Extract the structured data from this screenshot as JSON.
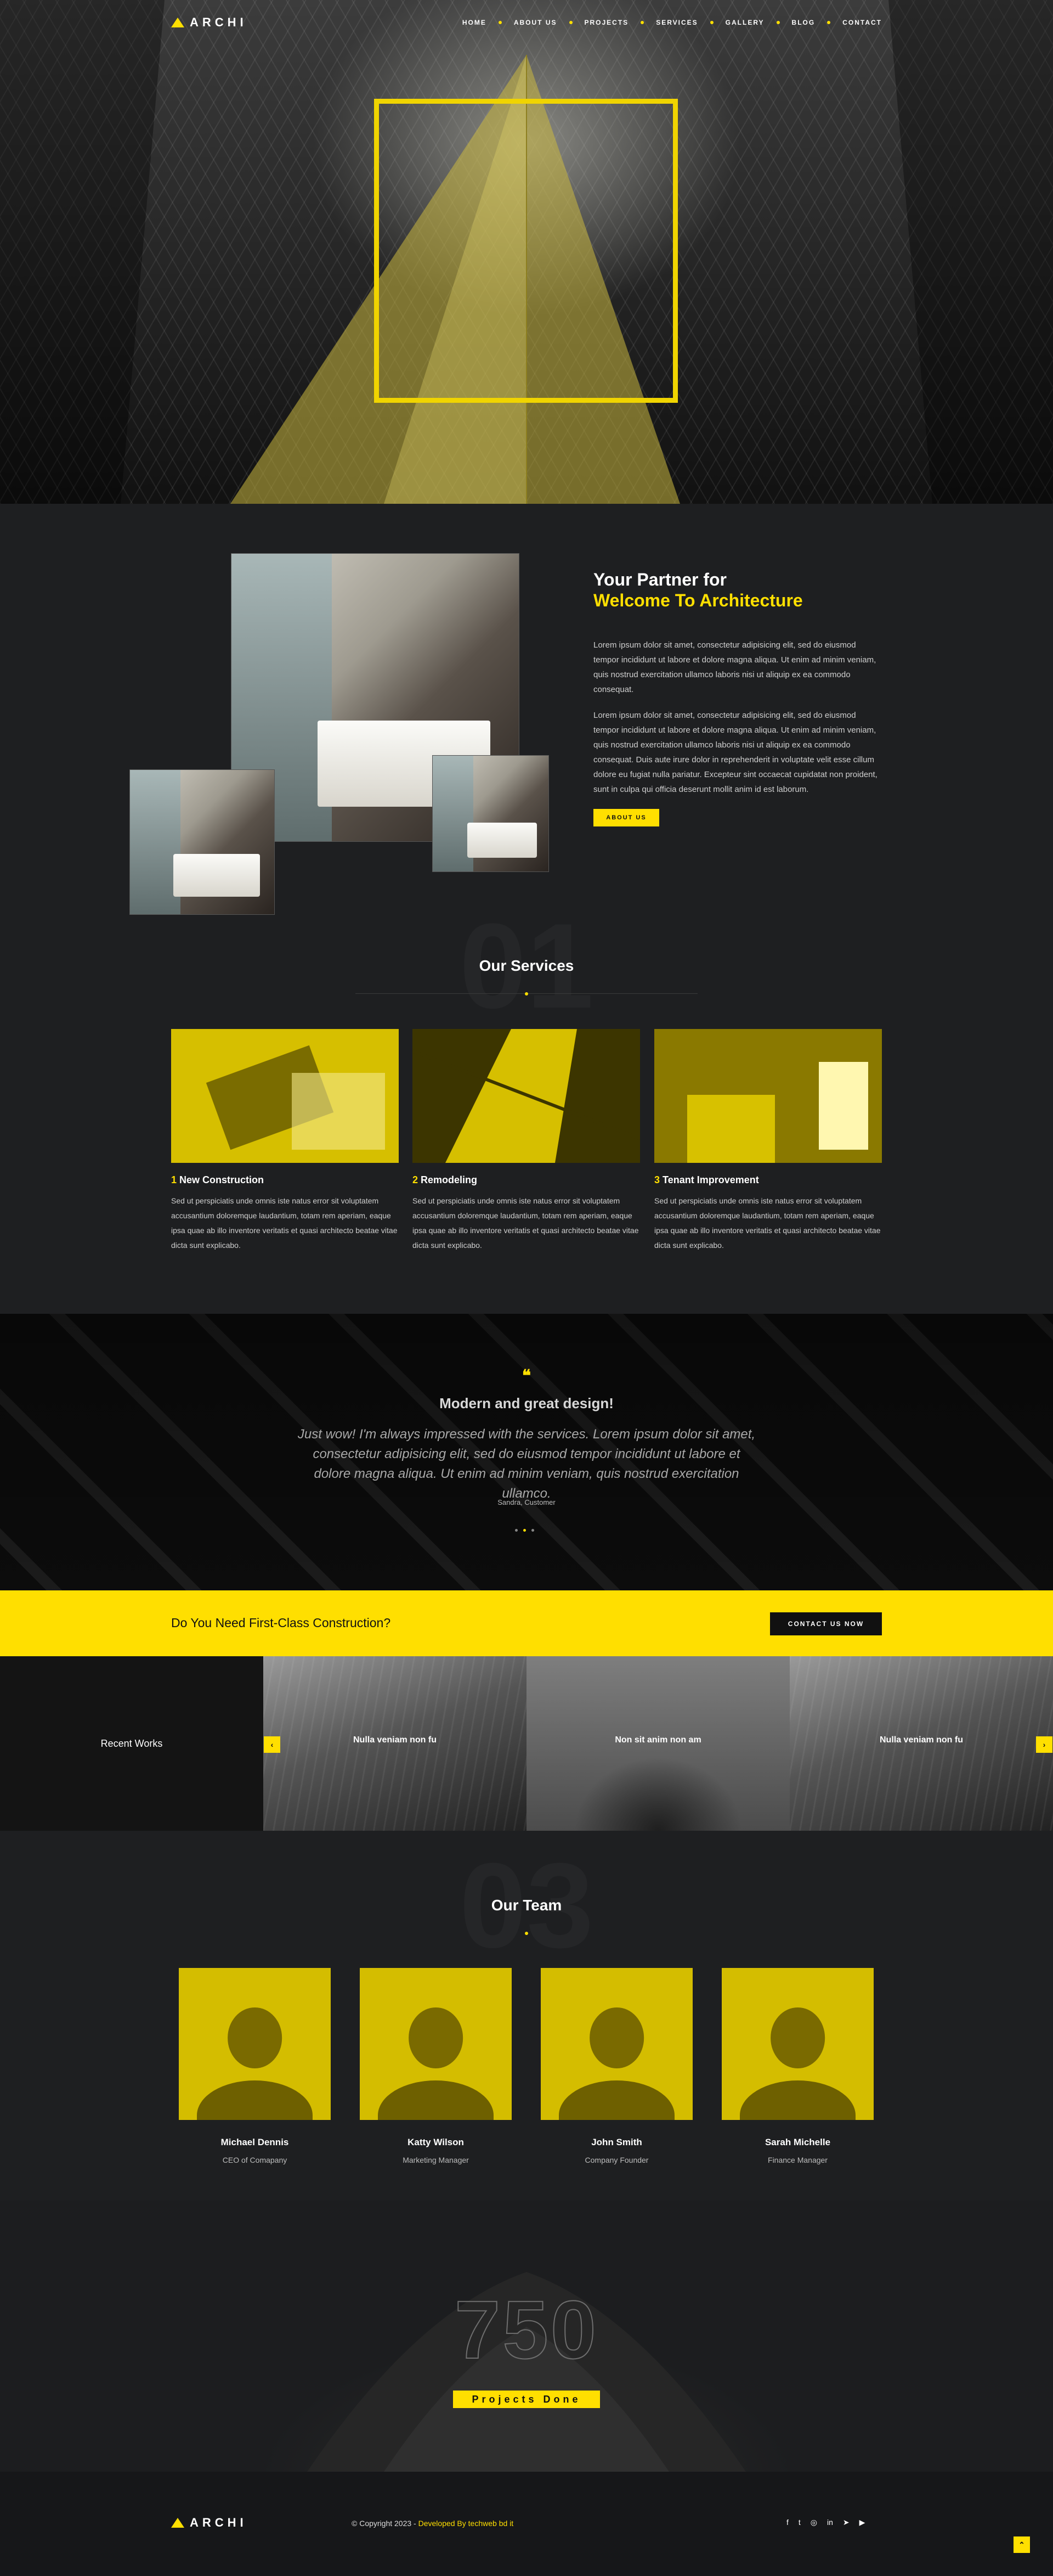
{
  "brand": {
    "name": "ARCHI",
    "accent": "#ffdf00"
  },
  "nav": {
    "items": [
      "HOME",
      "ABOUT US",
      "PROJECTS",
      "SERVICES",
      "GALLERY",
      "BLOG",
      "CONTACT"
    ]
  },
  "about": {
    "title_line1": "Your Partner for",
    "title_line2": "Welcome To Architecture",
    "para1": "Lorem ipsum dolor sit amet, consectetur adipisicing elit, sed do eiusmod tempor incididunt ut labore et dolore magna aliqua. Ut enim ad minim veniam, quis nostrud exercitation ullamco laboris nisi ut aliquip ex ea commodo consequat.",
    "para2": "Lorem ipsum dolor sit amet, consectetur adipisicing elit, sed do eiusmod tempor incididunt ut labore et dolore magna aliqua. Ut enim ad minim veniam, quis nostrud exercitation ullamco laboris nisi ut aliquip ex ea commodo consequat. Duis aute irure dolor in reprehenderit in voluptate velit esse cillum dolore eu fugiat nulla pariatur. Excepteur sint occaecat cupidatat non proident, sunt in culpa qui officia deserunt mollit anim id est laborum.",
    "button": "ABOUT US"
  },
  "services": {
    "bg_number": "01",
    "title": "Our Services",
    "items": [
      {
        "num": "1",
        "title": "New Construction",
        "text": "Sed ut perspiciatis unde omnis iste natus error sit voluptatem accusantium doloremque laudantium, totam rem aperiam, eaque ipsa quae ab illo inventore veritatis et quasi architecto beatae vitae dicta sunt explicabo."
      },
      {
        "num": "2",
        "title": "Remodeling",
        "text": "Sed ut perspiciatis unde omnis iste natus error sit voluptatem accusantium doloremque laudantium, totam rem aperiam, eaque ipsa quae ab illo inventore veritatis et quasi architecto beatae vitae dicta sunt explicabo."
      },
      {
        "num": "3",
        "title": "Tenant Improvement",
        "text": "Sed ut perspiciatis unde omnis iste natus error sit voluptatem accusantium doloremque laudantium, totam rem aperiam, eaque ipsa quae ab illo inventore veritatis et quasi architecto beatae vitae dicta sunt explicabo."
      }
    ]
  },
  "testimonial": {
    "quote_icon": "quote-icon",
    "title": "Modern and great design!",
    "quote": "Just wow! I'm always impressed with the services. Lorem ipsum dolor sit amet, consectetur adipisicing elit, sed do eiusmod tempor incididunt ut labore et dolore magna aliqua. Ut enim ad minim veniam, quis nostrud exercitation ullamco.",
    "author": "Sandra, Customer"
  },
  "cta": {
    "text": "Do You Need First-Class Construction?",
    "button": "CONTACT US NOW"
  },
  "works": {
    "label": "Recent Works",
    "items": [
      "Nulla veniam non fu",
      "Non sit anim non am",
      "Nulla veniam non fu"
    ]
  },
  "team": {
    "bg_number": "03",
    "title": "Our Team",
    "members": [
      {
        "name": "Michael Dennis",
        "role": "CEO of Comapany"
      },
      {
        "name": "Katty Wilson",
        "role": "Marketing Manager"
      },
      {
        "name": "John Smith",
        "role": "Company Founder"
      },
      {
        "name": "Sarah Michelle",
        "role": "Finance Manager"
      }
    ]
  },
  "counter": {
    "number": "750",
    "label": "Projects Done"
  },
  "footer": {
    "copyright": "© Copyright 2023 - ",
    "developer": "Developed By techweb bd it",
    "social_icons": [
      "facebook-icon",
      "twitter-icon",
      "instagram-icon",
      "linkedin-icon",
      "telegram-icon",
      "youtube-icon"
    ]
  }
}
